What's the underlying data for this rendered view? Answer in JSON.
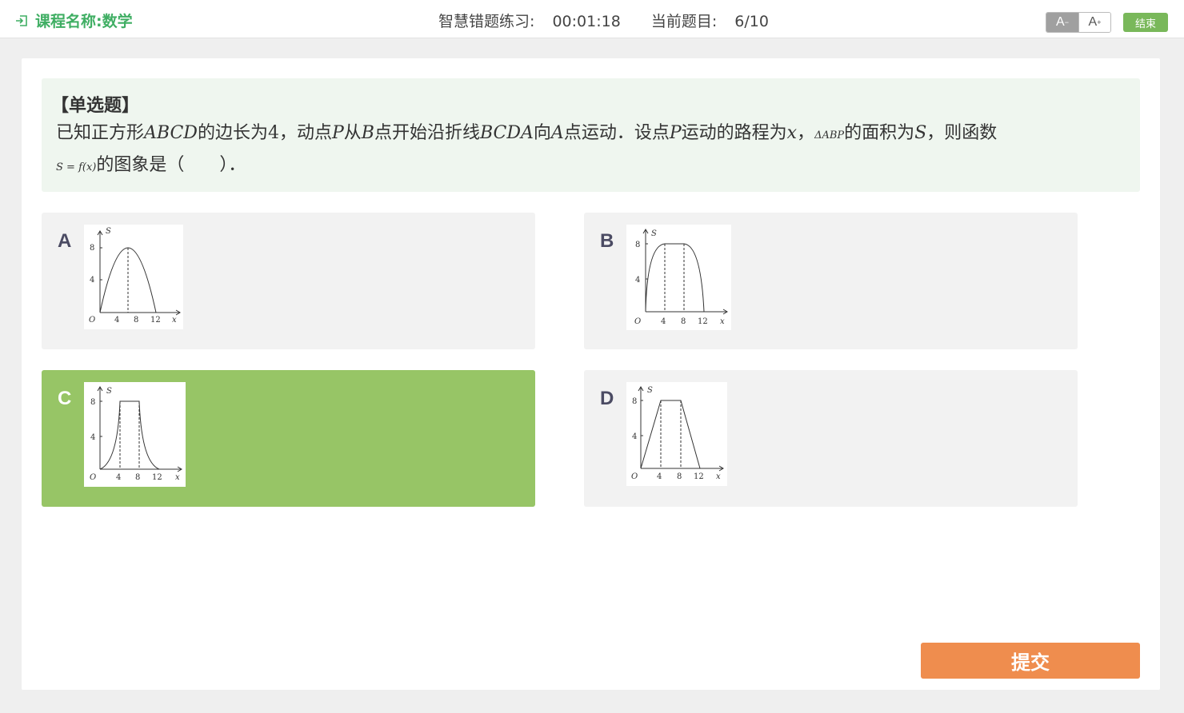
{
  "header": {
    "course_label": "课程名称:数学",
    "practice_label": "智慧错题练习:",
    "timer": "00:01:18",
    "question_label": "当前题目:",
    "question_progress": "6/10",
    "font_decrease": "A",
    "font_increase": "A",
    "end_label": "结束"
  },
  "question": {
    "type": "【单选题】",
    "line1_parts": [
      "已知正方形",
      "ABCD",
      "的边长为4，动点",
      "P",
      "从",
      "B",
      "点开始沿折线",
      "BCDA",
      "向",
      "A",
      "点运动．设点",
      "P",
      "运动的路程为",
      "x",
      "，",
      "ΔABP",
      "的面积为",
      "S",
      "，则函数"
    ],
    "line2_parts": [
      "S = f(x)",
      "的图象是（　　）．"
    ]
  },
  "options": [
    {
      "letter": "A",
      "selected": false,
      "graph": {
        "y_ticks": [
          "8",
          "4"
        ],
        "x_ticks": [
          "4",
          "8",
          "12"
        ],
        "origin": "O",
        "x_axis": "x",
        "y_axis": "S"
      }
    },
    {
      "letter": "B",
      "selected": false,
      "graph": {
        "y_ticks": [
          "8",
          "4"
        ],
        "x_ticks": [
          "4",
          "8",
          "12"
        ],
        "origin": "O",
        "x_axis": "x",
        "y_axis": "S"
      }
    },
    {
      "letter": "C",
      "selected": true,
      "graph": {
        "y_ticks": [
          "8",
          "4"
        ],
        "x_ticks": [
          "4",
          "8",
          "12"
        ],
        "origin": "O",
        "x_axis": "x",
        "y_axis": "S"
      }
    },
    {
      "letter": "D",
      "selected": false,
      "graph": {
        "y_ticks": [
          "8",
          "4"
        ],
        "x_ticks": [
          "4",
          "8",
          "12"
        ],
        "origin": "O",
        "x_axis": "x",
        "y_axis": "S"
      }
    }
  ],
  "submit_label": "提交",
  "colors": {
    "accent_green": "#3fae63",
    "selected_option": "#97c566",
    "submit": "#ef8d4e",
    "end_button": "#79b85a"
  }
}
